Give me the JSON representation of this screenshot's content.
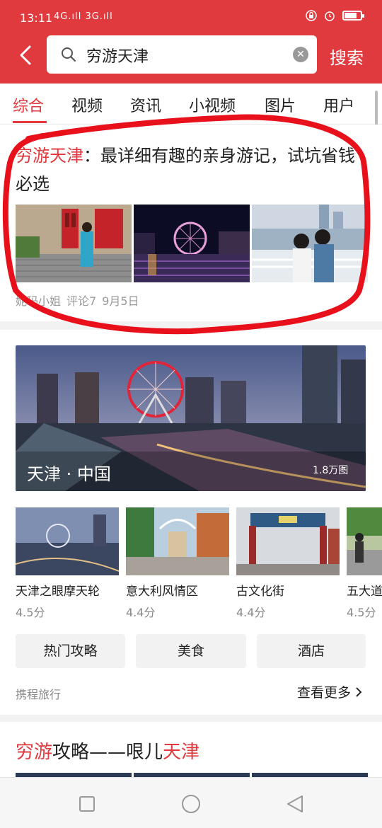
{
  "status_bar": {
    "time": "13:11",
    "signal": "4G.ıll 3G.ıll",
    "battery_level": 0.75
  },
  "search": {
    "query": "穷游天津",
    "button_label": "搜索"
  },
  "tabs": [
    {
      "label": "综合",
      "active": true
    },
    {
      "label": "视频"
    },
    {
      "label": "资讯"
    },
    {
      "label": "小视频"
    },
    {
      "label": "图片"
    },
    {
      "label": "用户"
    }
  ],
  "article": {
    "title_highlight": "穷游天津",
    "title_rest": "：最详细有趣的亲身游记，试坑省钱必选",
    "author": "妮玛小姐",
    "comments": "评论7",
    "date": "9月5日"
  },
  "travel_card": {
    "banner_title": "天津 · 中国",
    "banner_count": "1.8万图",
    "pois": [
      {
        "name": "天津之眼摩天轮",
        "score": "4.5分"
      },
      {
        "name": "意大利风情区",
        "score": "4.4分"
      },
      {
        "name": "古文化街",
        "score": "4.4分"
      },
      {
        "name": "五大道",
        "score": "4.5分"
      }
    ],
    "chips": [
      "热门攻略",
      "美食",
      "酒店"
    ],
    "source": "携程旅行",
    "more_label": "查看更多"
  },
  "guide": {
    "t1": "穷游",
    "t2": "攻略——哏儿",
    "t3": "天津"
  },
  "colors": {
    "accent": "#e03a3e",
    "annotation": "#e8101a"
  }
}
